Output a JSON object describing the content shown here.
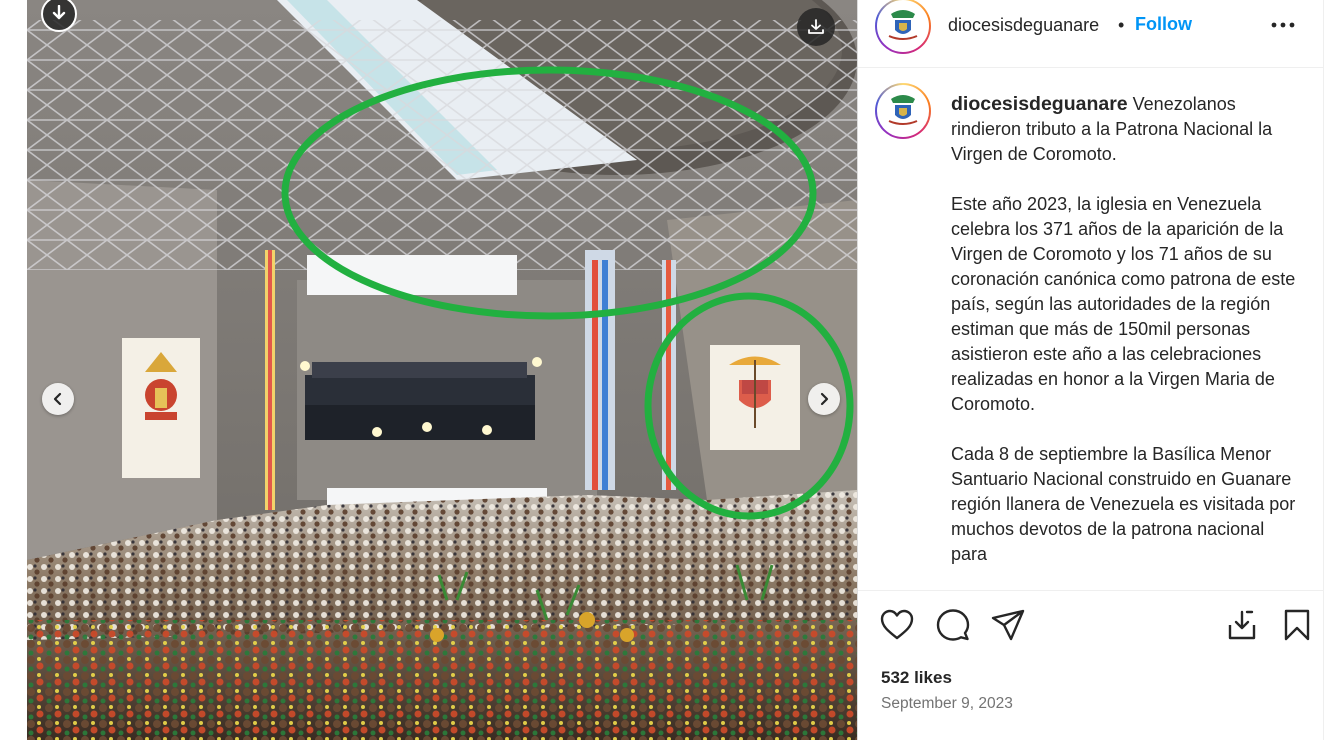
{
  "post": {
    "username": "diocesisdeguanare",
    "separator": "•",
    "follow_label": "Follow",
    "caption_user": "diocesisdeguanare",
    "caption_intro": " Venezolanos rindieron tributo a la Patrona Nacional la Virgen de Coromoto.",
    "caption_p2": "Este año 2023, la iglesia en Venezuela celebra los 371 años de la aparición de la Virgen de Coromoto y los 71 años de su coronación canónica como patrona de este país, según las autoridades de la región estiman que más de 150mil personas asistieron este año a las celebraciones realizadas en honor a la Virgen Maria de Coromoto.",
    "caption_p3": "Cada 8 de septiembre la Basílica Menor Santuario Nacional construido en Guanare región llanera de Venezuela es visitada por muchos devotos de la patrona nacional para",
    "likes": "532 likes",
    "date": "September 9, 2023"
  },
  "icons": {
    "more": "more-horizontal-icon",
    "like": "heart-icon",
    "comment": "comment-icon",
    "share": "paper-plane-icon",
    "download": "download-icon",
    "save": "bookmark-icon",
    "prev": "chevron-left-icon",
    "next": "chevron-right-icon"
  },
  "colors": {
    "accent": "#0095f6",
    "annotation": "#22b040",
    "text": "#262626",
    "muted": "#737373"
  }
}
